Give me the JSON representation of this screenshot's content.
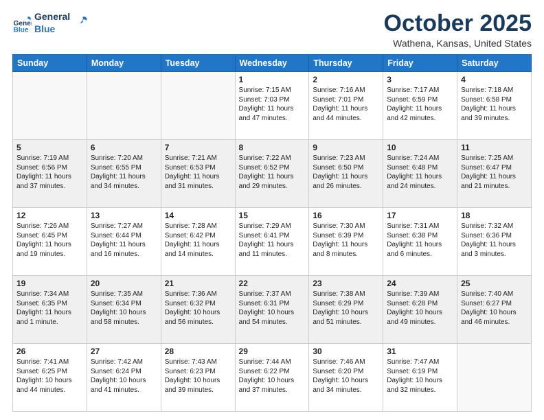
{
  "header": {
    "logo_line1": "General",
    "logo_line2": "Blue",
    "month": "October 2025",
    "location": "Wathena, Kansas, United States"
  },
  "days_of_week": [
    "Sunday",
    "Monday",
    "Tuesday",
    "Wednesday",
    "Thursday",
    "Friday",
    "Saturday"
  ],
  "weeks": [
    [
      {
        "day": "",
        "text": ""
      },
      {
        "day": "",
        "text": ""
      },
      {
        "day": "",
        "text": ""
      },
      {
        "day": "1",
        "text": "Sunrise: 7:15 AM\nSunset: 7:03 PM\nDaylight: 11 hours\nand 47 minutes."
      },
      {
        "day": "2",
        "text": "Sunrise: 7:16 AM\nSunset: 7:01 PM\nDaylight: 11 hours\nand 44 minutes."
      },
      {
        "day": "3",
        "text": "Sunrise: 7:17 AM\nSunset: 6:59 PM\nDaylight: 11 hours\nand 42 minutes."
      },
      {
        "day": "4",
        "text": "Sunrise: 7:18 AM\nSunset: 6:58 PM\nDaylight: 11 hours\nand 39 minutes."
      }
    ],
    [
      {
        "day": "5",
        "text": "Sunrise: 7:19 AM\nSunset: 6:56 PM\nDaylight: 11 hours\nand 37 minutes."
      },
      {
        "day": "6",
        "text": "Sunrise: 7:20 AM\nSunset: 6:55 PM\nDaylight: 11 hours\nand 34 minutes."
      },
      {
        "day": "7",
        "text": "Sunrise: 7:21 AM\nSunset: 6:53 PM\nDaylight: 11 hours\nand 31 minutes."
      },
      {
        "day": "8",
        "text": "Sunrise: 7:22 AM\nSunset: 6:52 PM\nDaylight: 11 hours\nand 29 minutes."
      },
      {
        "day": "9",
        "text": "Sunrise: 7:23 AM\nSunset: 6:50 PM\nDaylight: 11 hours\nand 26 minutes."
      },
      {
        "day": "10",
        "text": "Sunrise: 7:24 AM\nSunset: 6:48 PM\nDaylight: 11 hours\nand 24 minutes."
      },
      {
        "day": "11",
        "text": "Sunrise: 7:25 AM\nSunset: 6:47 PM\nDaylight: 11 hours\nand 21 minutes."
      }
    ],
    [
      {
        "day": "12",
        "text": "Sunrise: 7:26 AM\nSunset: 6:45 PM\nDaylight: 11 hours\nand 19 minutes."
      },
      {
        "day": "13",
        "text": "Sunrise: 7:27 AM\nSunset: 6:44 PM\nDaylight: 11 hours\nand 16 minutes."
      },
      {
        "day": "14",
        "text": "Sunrise: 7:28 AM\nSunset: 6:42 PM\nDaylight: 11 hours\nand 14 minutes."
      },
      {
        "day": "15",
        "text": "Sunrise: 7:29 AM\nSunset: 6:41 PM\nDaylight: 11 hours\nand 11 minutes."
      },
      {
        "day": "16",
        "text": "Sunrise: 7:30 AM\nSunset: 6:39 PM\nDaylight: 11 hours\nand 8 minutes."
      },
      {
        "day": "17",
        "text": "Sunrise: 7:31 AM\nSunset: 6:38 PM\nDaylight: 11 hours\nand 6 minutes."
      },
      {
        "day": "18",
        "text": "Sunrise: 7:32 AM\nSunset: 6:36 PM\nDaylight: 11 hours\nand 3 minutes."
      }
    ],
    [
      {
        "day": "19",
        "text": "Sunrise: 7:34 AM\nSunset: 6:35 PM\nDaylight: 11 hours\nand 1 minute."
      },
      {
        "day": "20",
        "text": "Sunrise: 7:35 AM\nSunset: 6:34 PM\nDaylight: 10 hours\nand 58 minutes."
      },
      {
        "day": "21",
        "text": "Sunrise: 7:36 AM\nSunset: 6:32 PM\nDaylight: 10 hours\nand 56 minutes."
      },
      {
        "day": "22",
        "text": "Sunrise: 7:37 AM\nSunset: 6:31 PM\nDaylight: 10 hours\nand 54 minutes."
      },
      {
        "day": "23",
        "text": "Sunrise: 7:38 AM\nSunset: 6:29 PM\nDaylight: 10 hours\nand 51 minutes."
      },
      {
        "day": "24",
        "text": "Sunrise: 7:39 AM\nSunset: 6:28 PM\nDaylight: 10 hours\nand 49 minutes."
      },
      {
        "day": "25",
        "text": "Sunrise: 7:40 AM\nSunset: 6:27 PM\nDaylight: 10 hours\nand 46 minutes."
      }
    ],
    [
      {
        "day": "26",
        "text": "Sunrise: 7:41 AM\nSunset: 6:25 PM\nDaylight: 10 hours\nand 44 minutes."
      },
      {
        "day": "27",
        "text": "Sunrise: 7:42 AM\nSunset: 6:24 PM\nDaylight: 10 hours\nand 41 minutes."
      },
      {
        "day": "28",
        "text": "Sunrise: 7:43 AM\nSunset: 6:23 PM\nDaylight: 10 hours\nand 39 minutes."
      },
      {
        "day": "29",
        "text": "Sunrise: 7:44 AM\nSunset: 6:22 PM\nDaylight: 10 hours\nand 37 minutes."
      },
      {
        "day": "30",
        "text": "Sunrise: 7:46 AM\nSunset: 6:20 PM\nDaylight: 10 hours\nand 34 minutes."
      },
      {
        "day": "31",
        "text": "Sunrise: 7:47 AM\nSunset: 6:19 PM\nDaylight: 10 hours\nand 32 minutes."
      },
      {
        "day": "",
        "text": ""
      }
    ]
  ]
}
